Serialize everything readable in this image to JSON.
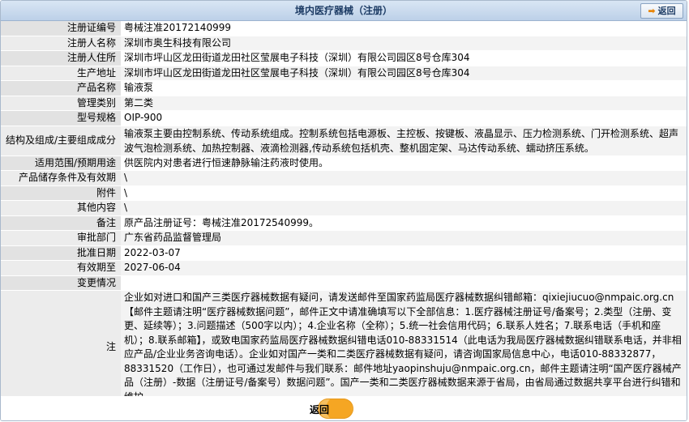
{
  "header": {
    "title": "境内医疗器械（注册）",
    "back_label": "返回"
  },
  "rows": {
    "reg_no": {
      "label": "注册证编号",
      "value": "粤械注准20172140999"
    },
    "applicant": {
      "label": "注册人名称",
      "value": "深圳市奥生科技有限公司"
    },
    "address": {
      "label": "注册人住所",
      "value": "深圳市坪山区龙田街道龙田社区莹展电子科技（深圳）有限公司园区8号仓库304"
    },
    "prod_addr": {
      "label": "生产地址",
      "value": "深圳市坪山区龙田街道龙田社区莹展电子科技（深圳）有限公司园区8号仓库304"
    },
    "product": {
      "label": "产品名称",
      "value": "输液泵"
    },
    "category": {
      "label": "管理类别",
      "value": "第二类"
    },
    "model": {
      "label": "型号规格",
      "value": "OIP-900"
    },
    "structure": {
      "label": "结构及组成/主要组成成分",
      "value": "输液泵主要由控制系统、传动系统组成。控制系统包括电源板、主控板、按键板、液晶显示、压力检测系统、门开检测系统、超声波气泡检测系统、加热控制器、液滴检测器,传动系统包括机壳、整机固定架、马达传动系统、蠕动挤压系统。"
    },
    "scope": {
      "label": "适用范围/预期用途",
      "value": "供医院内对患者进行恒速静脉输注药液时使用。"
    },
    "storage": {
      "label": "产品储存条件及有效期",
      "value": "\\"
    },
    "attach": {
      "label": "附件",
      "value": "\\"
    },
    "other": {
      "label": "其他内容",
      "value": "\\"
    },
    "remark": {
      "label": "备注",
      "value": "原产品注册证号：粤械注准20172540999。"
    },
    "dept": {
      "label": "审批部门",
      "value": "广东省药品监督管理局"
    },
    "approve": {
      "label": "批准日期",
      "value": "2022-03-07"
    },
    "expire": {
      "label": "有效期至",
      "value": "2027-06-04"
    },
    "change": {
      "label": "变更情况",
      "value": ""
    },
    "note": {
      "label": "注",
      "value": "企业如对进口和国产三类医疗器械数据有疑问，请发送邮件至国家药监局医疗器械数据纠错邮箱：qixiejiucuo@nmpaic.org.cn【邮件主题请注明“医疗器械数据问题”，邮件正文中请准确填写以下全部信息：1.医疗器械注册证号/备案号；2.类型（注册、变更、延续等）；3.问题描述（500字以内）；4.企业名称（全称）；5.统一社会信用代码；6.联系人姓名；7.联系电话（手机和座机）；8.联系邮箱】，或致电国家药监局医疗器械数据纠错电话010-88331514（此电话为我局医疗器械数据纠错联系电话，并非相应产品/企业业务咨询电话）。企业如对国产一类和二类医疗器械数据有疑问，请咨询国家局信息中心，电话010-88332877，88331520（工作日），也可通过发邮件与我们联系：邮件地址yaopinshuju@nmpaic.org.cn，邮件主题请注明“国产医疗器械产品（注册）-数据（注册证号/备案号）数据问题”。国产一类和二类医疗器械数据来源于省局，由省局通过数据共享平台进行纠错和维护。"
    }
  },
  "footer": {
    "back_label": "返回"
  },
  "colors": {
    "header_bg": "#c9daee",
    "label_bg": "#e2e2e2",
    "accent": "#f5a623"
  }
}
